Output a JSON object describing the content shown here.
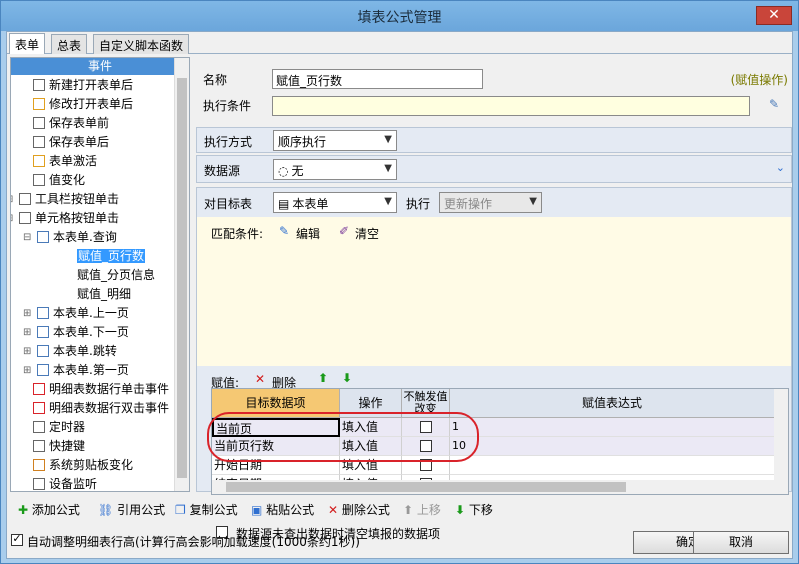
{
  "window": {
    "title": "填表公式管理",
    "close": "✕"
  },
  "tabs": [
    "表单",
    "总表",
    "自定义脚本函数"
  ],
  "tree": {
    "header": "事件",
    "items": [
      {
        "label": "新建打开表单后"
      },
      {
        "label": "修改打开表单后"
      },
      {
        "label": "保存表单前"
      },
      {
        "label": "保存表单后"
      },
      {
        "label": "表单激活"
      },
      {
        "label": "值变化"
      },
      {
        "label": "工具栏按钮单击"
      },
      {
        "label": "单元格按钮单击"
      },
      {
        "label": "本表单.查询"
      },
      {
        "label": "赋值_页行数"
      },
      {
        "label": "赋值_分页信息"
      },
      {
        "label": "赋值_明细"
      },
      {
        "label": "本表单.上一页"
      },
      {
        "label": "本表单.下一页"
      },
      {
        "label": "本表单.跳转"
      },
      {
        "label": "本表单.第一页"
      },
      {
        "label": "明细表数据行单击事件"
      },
      {
        "label": "明细表数据行双击事件"
      },
      {
        "label": "定时器"
      },
      {
        "label": "快捷键"
      },
      {
        "label": "系统剪贴板变化"
      },
      {
        "label": "设备监听"
      }
    ]
  },
  "form": {
    "name_label": "名称",
    "name_value": "赋值_页行数",
    "op_tag": "(赋值操作)",
    "cond_label": "执行条件",
    "exec_label": "执行方式",
    "exec_value": "顺序执行",
    "ds_label": "数据源",
    "ds_value": "无",
    "target_label": "对目标表",
    "target_value": "本表单",
    "exec2_label": "执行",
    "exec2_value": "更新操作",
    "match_label": "匹配条件:",
    "edit_label": "编辑",
    "clear_label": "清空",
    "assign_label": "赋值:",
    "delete_label": "删除",
    "clear_check_label": "数据源未查出数据时清空填报的数据项"
  },
  "grid": {
    "headers": [
      "目标数据项",
      "操作",
      "不触发值改变",
      "赋值表达式"
    ],
    "rows": [
      {
        "target": "当前页",
        "op": "填入值",
        "expr": "1"
      },
      {
        "target": "当前页行数",
        "op": "填入值",
        "expr": "10"
      },
      {
        "target": "开始日期",
        "op": "填入值",
        "expr": ""
      },
      {
        "target": "结束日期",
        "op": "填入值",
        "expr": ""
      }
    ]
  },
  "toolbar": {
    "add": "添加公式",
    "ref": "引用公式",
    "copy": "复制公式",
    "paste": "粘贴公式",
    "del": "删除公式",
    "up": "上移",
    "down": "下移"
  },
  "footer": {
    "auto_label": "自动调整明细表行高(计算行高会影响加载速度(1000条约1秒))",
    "ok": "确定",
    "cancel": "取消"
  }
}
